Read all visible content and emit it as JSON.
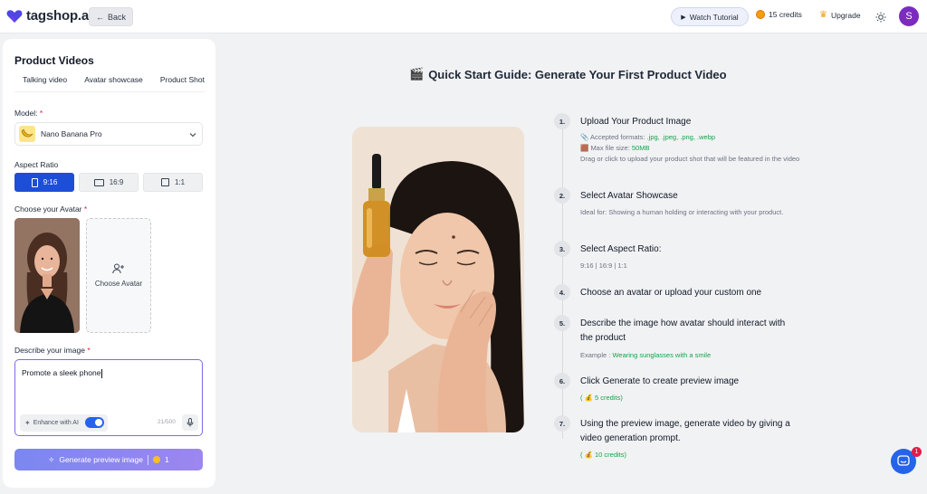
{
  "header": {
    "logo_text": "tagshop.ai",
    "back_label": "Back",
    "watch_tutorial_label": "Watch Tutorial",
    "credits_label": "15 credits",
    "upgrade_label": "Upgrade",
    "user_initial": "S"
  },
  "panel": {
    "title": "Product Videos",
    "tabs": [
      "Talking video",
      "Avatar showcase",
      "Product Shot"
    ],
    "model_label": "Model:",
    "model_value": "Nano Banana Pro",
    "aspect_label": "Aspect Ratio",
    "aspect_options": [
      "9:16",
      "16:9",
      "1:1"
    ],
    "aspect_selected": "9:16",
    "avatar_label": "Choose your Avatar",
    "choose_avatar_label": "Choose Avatar",
    "describe_label": "Describe your image",
    "prompt_value": "Promote a sleek phone",
    "enhance_label": "Enhance with AI",
    "char_count": "21/500",
    "generate_label": "Generate preview image",
    "generate_cost": "1"
  },
  "guide": {
    "title": "Quick Start Guide: Generate Your First Product Video",
    "steps": [
      {
        "num": "1.",
        "title": "Upload Your Product Image",
        "formats_label": "Accepted formats:",
        "formats_value": ".jpg, .jpeg, .png, .webp",
        "size_label": "Max file size:",
        "size_value": "50MB",
        "desc": "Drag or click to upload your product shot that will be featured in the video"
      },
      {
        "num": "2.",
        "title": "Select Avatar Showcase",
        "desc": "Ideal for: Showing a human holding or interacting with your product."
      },
      {
        "num": "3.",
        "title": "Select Aspect Ratio:",
        "desc": "9:16 | 16:9 | 1:1"
      },
      {
        "num": "4.",
        "title": "Choose an avatar or upload your custom one"
      },
      {
        "num": "5.",
        "title": "Describe the image how avatar should interact with the product",
        "example_label": "Example :",
        "example_value": "Wearing sunglasses with a smile"
      },
      {
        "num": "6.",
        "title": "Click Generate to create preview image",
        "credits": "( 💰 5 credits)"
      },
      {
        "num": "7.",
        "title": "Using the preview image, generate video by giving a video generation prompt.",
        "credits": "( 💰 10 credits)"
      }
    ]
  },
  "chat": {
    "badge": "1"
  }
}
